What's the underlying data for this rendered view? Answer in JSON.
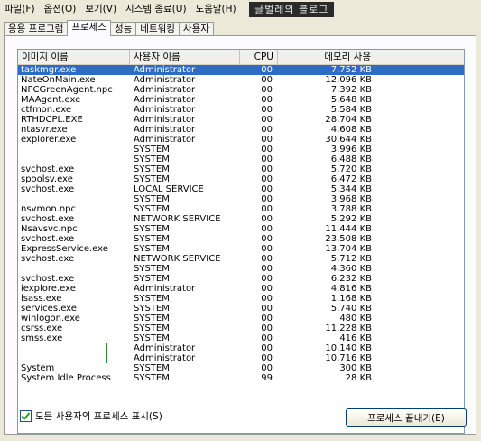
{
  "watermark": "글벌레의 블로그",
  "menu": [
    "파일(F)",
    "옵션(O)",
    "보기(V)",
    "시스템 종료(U)",
    "도움말(H)"
  ],
  "tabs": [
    "응용 프로그램",
    "프로세스",
    "성능",
    "네트워킹",
    "사용자"
  ],
  "active_tab": "프로세스",
  "columns": [
    "이미지 이름",
    "사용자 이름",
    "CPU",
    "메모리 사용"
  ],
  "rows": [
    {
      "name": "taskmgr.exe",
      "user": "Administrator",
      "cpu": "00",
      "mem": "7,752 KB",
      "selected": true
    },
    {
      "name": "NateOnMain.exe",
      "user": "Administrator",
      "cpu": "00",
      "mem": "12,096 KB"
    },
    {
      "name": "NPCGreenAgent.npc",
      "user": "Administrator",
      "cpu": "00",
      "mem": "7,392 KB"
    },
    {
      "name": "MAAgent.exe",
      "user": "Administrator",
      "cpu": "00",
      "mem": "5,648 KB"
    },
    {
      "name": "ctfmon.exe",
      "user": "Administrator",
      "cpu": "00",
      "mem": "5,584 KB"
    },
    {
      "name": "RTHDCPL.EXE",
      "user": "Administrator",
      "cpu": "00",
      "mem": "28,704 KB"
    },
    {
      "name": "ntasvr.exe",
      "user": "Administrator",
      "cpu": "00",
      "mem": "4,608 KB"
    },
    {
      "name": "explorer.exe",
      "user": "Administrator",
      "cpu": "00",
      "mem": "30,644 KB"
    },
    {
      "name": "",
      "user": "SYSTEM",
      "cpu": "00",
      "mem": "3,996 KB"
    },
    {
      "name": "",
      "user": "SYSTEM",
      "cpu": "00",
      "mem": "6,488 KB"
    },
    {
      "name": "svchost.exe",
      "user": "SYSTEM",
      "cpu": "00",
      "mem": "5,720 KB"
    },
    {
      "name": "spoolsv.exe",
      "user": "SYSTEM",
      "cpu": "00",
      "mem": "6,472 KB"
    },
    {
      "name": "svchost.exe",
      "user": "LOCAL SERVICE",
      "cpu": "00",
      "mem": "5,344 KB"
    },
    {
      "name": "",
      "user": "SYSTEM",
      "cpu": "00",
      "mem": "3,968 KB"
    },
    {
      "name": "nsvmon.npc",
      "user": "SYSTEM",
      "cpu": "00",
      "mem": "3,788 KB"
    },
    {
      "name": "svchost.exe",
      "user": "NETWORK SERVICE",
      "cpu": "00",
      "mem": "5,292 KB"
    },
    {
      "name": "Nsavsvc.npc",
      "user": "SYSTEM",
      "cpu": "00",
      "mem": "11,444 KB"
    },
    {
      "name": "svchost.exe",
      "user": "SYSTEM",
      "cpu": "00",
      "mem": "23,508 KB"
    },
    {
      "name": "ExpressService.exe",
      "user": "SYSTEM",
      "cpu": "00",
      "mem": "13,704 KB"
    },
    {
      "name": "svchost.exe",
      "user": "NETWORK SERVICE",
      "cpu": "00",
      "mem": "5,712 KB"
    },
    {
      "name": "",
      "user": "SYSTEM",
      "cpu": "00",
      "mem": "4,360 KB"
    },
    {
      "name": "svchost.exe",
      "user": "SYSTEM",
      "cpu": "00",
      "mem": "6,232 KB"
    },
    {
      "name": "iexplore.exe",
      "user": "Administrator",
      "cpu": "00",
      "mem": "4,816 KB"
    },
    {
      "name": "lsass.exe",
      "user": "SYSTEM",
      "cpu": "00",
      "mem": "1,168 KB"
    },
    {
      "name": "services.exe",
      "user": "SYSTEM",
      "cpu": "00",
      "mem": "5,740 KB"
    },
    {
      "name": "winlogon.exe",
      "user": "SYSTEM",
      "cpu": "00",
      "mem": "480 KB"
    },
    {
      "name": "csrss.exe",
      "user": "SYSTEM",
      "cpu": "00",
      "mem": "11,228 KB"
    },
    {
      "name": "smss.exe",
      "user": "SYSTEM",
      "cpu": "00",
      "mem": "416 KB"
    },
    {
      "name": "",
      "user": "Administrator",
      "cpu": "00",
      "mem": "10,140 KB"
    },
    {
      "name": "",
      "user": "Administrator",
      "cpu": "00",
      "mem": "10,716 KB"
    },
    {
      "name": "System",
      "user": "SYSTEM",
      "cpu": "00",
      "mem": "300 KB"
    },
    {
      "name": "System Idle Process",
      "user": "SYSTEM",
      "cpu": "99",
      "mem": "28 KB"
    }
  ],
  "show_all_label": "모든 사용자의 프로세스 표시(S)",
  "show_all_checked": true,
  "end_process_label": "프로세스 끝내기(E)"
}
